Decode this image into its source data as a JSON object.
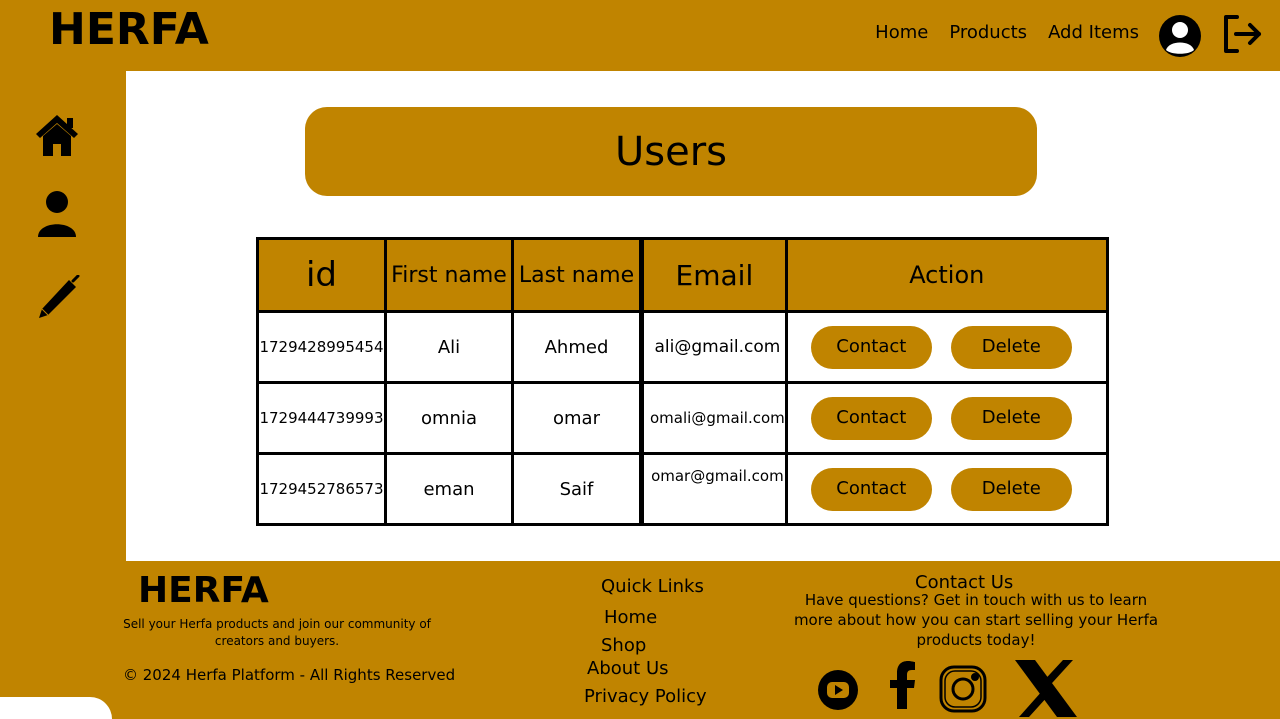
{
  "colors": {
    "brand_gold": "#c08400",
    "text": "#000000",
    "background": "#ffffff"
  },
  "header": {
    "brand": "HERFA",
    "nav": [
      "Home",
      "Products",
      "Add Items"
    ],
    "icons": [
      "user-avatar-icon",
      "logout-icon"
    ]
  },
  "sidebar": {
    "icons": [
      "home-icon",
      "user-icon",
      "pen-icon"
    ]
  },
  "main": {
    "title": "Users",
    "table": {
      "headers": [
        "id",
        "First name",
        "Last name",
        "Email",
        "Action"
      ],
      "rows": [
        {
          "id": "1729428995454",
          "first": "Ali",
          "last": "Ahmed",
          "email": "ali@gmail.com"
        },
        {
          "id": "1729444739993",
          "first": "omnia",
          "last": "omar",
          "email": "omali@gmail.com"
        },
        {
          "id": "1729452786573",
          "first": "eman",
          "last": "Saif",
          "email": "omar@gmail.com"
        }
      ],
      "contact_label": "Contact",
      "delete_label": "Delete"
    }
  },
  "footer": {
    "brand": "HERFA",
    "tagline": "Sell your Herfa products and join our community of creators and buyers.",
    "copyright": "© 2024 Herfa Platform - All Rights Reserved",
    "quick_links_title": "Quick Links",
    "quick_links": [
      "Home",
      "Shop",
      "About Us",
      "Privacy Policy"
    ],
    "contact_title": "Contact Us",
    "contact_text": "Have questions? Get in touch with us to learn more about how you can start selling your Herfa products today!",
    "social_icons": [
      "youtube-icon",
      "facebook-icon",
      "instagram-icon",
      "x-icon"
    ]
  }
}
